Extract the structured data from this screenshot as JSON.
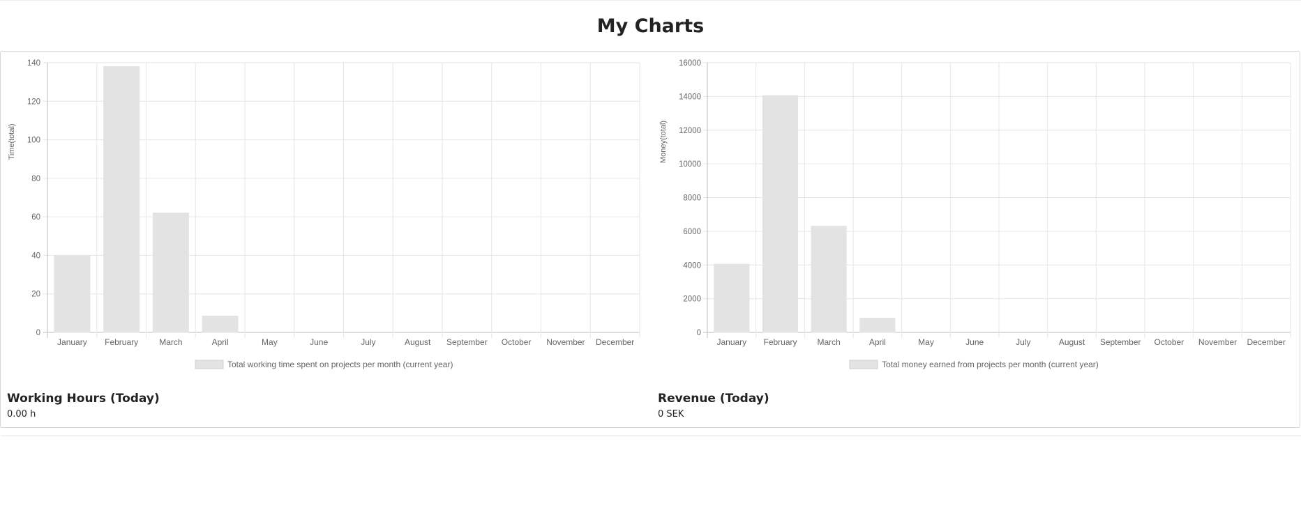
{
  "page": {
    "title": "My Charts"
  },
  "chart_data": [
    {
      "type": "bar",
      "categories": [
        "January",
        "February",
        "March",
        "April",
        "May",
        "June",
        "July",
        "August",
        "September",
        "October",
        "November",
        "December"
      ],
      "values": [
        40,
        138,
        62,
        8.5,
        0,
        0,
        0,
        0,
        0,
        0,
        0,
        0
      ],
      "ylabel": "Time(total)",
      "ylim": [
        0,
        140
      ],
      "yticks": [
        0,
        20,
        40,
        60,
        80,
        100,
        120,
        140
      ],
      "legend": "Total working time spent on projects per month (current year)",
      "legend_position": "bottom",
      "grid": true,
      "bar_color": "#e3e3e3"
    },
    {
      "type": "bar",
      "categories": [
        "January",
        "February",
        "March",
        "April",
        "May",
        "June",
        "July",
        "August",
        "September",
        "October",
        "November",
        "December"
      ],
      "values": [
        4050,
        14050,
        6300,
        850,
        0,
        0,
        0,
        0,
        0,
        0,
        0,
        0
      ],
      "ylabel": "Money(total)",
      "ylim": [
        0,
        16000
      ],
      "yticks": [
        0,
        2000,
        4000,
        6000,
        8000,
        10000,
        12000,
        14000,
        16000
      ],
      "legend": "Total money earned from projects per month (current year)",
      "legend_position": "bottom",
      "grid": true,
      "bar_color": "#e3e3e3"
    }
  ],
  "stats": {
    "hours": {
      "title": "Working Hours (Today)",
      "value": "0.00 h"
    },
    "revenue": {
      "title": "Revenue (Today)",
      "value": "0 SEK"
    }
  }
}
